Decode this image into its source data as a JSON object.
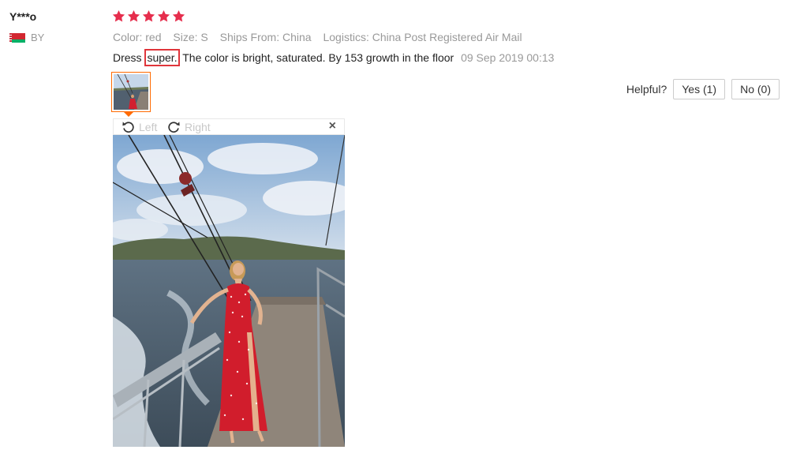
{
  "reviewer": {
    "name": "Y***o",
    "country_code": "BY",
    "flag": "belarus-flag"
  },
  "rating": {
    "stars": 5,
    "max": 5,
    "color": "#e62e4d"
  },
  "attributes": [
    {
      "key": "Color:",
      "value": "red"
    },
    {
      "key": "Size:",
      "value": "S"
    },
    {
      "key": "Ships From:",
      "value": "China"
    },
    {
      "key": "Logistics:",
      "value": "China Post Registered Air Mail"
    }
  ],
  "feedback": {
    "prefix": "Dress",
    "highlight": "super.",
    "rest": "The color is bright, saturated. By 153 growth in the floor",
    "date": "09 Sep 2019 00:13",
    "highlight_color": "#e0353b"
  },
  "viewer": {
    "rotate_left_label": "Left",
    "rotate_right_label": "Right",
    "close_icon": "close-icon",
    "thumb_border_color": "#ff6a00"
  },
  "helpful": {
    "label": "Helpful?",
    "yes_label": "Yes (1)",
    "no_label": "No (0)"
  }
}
